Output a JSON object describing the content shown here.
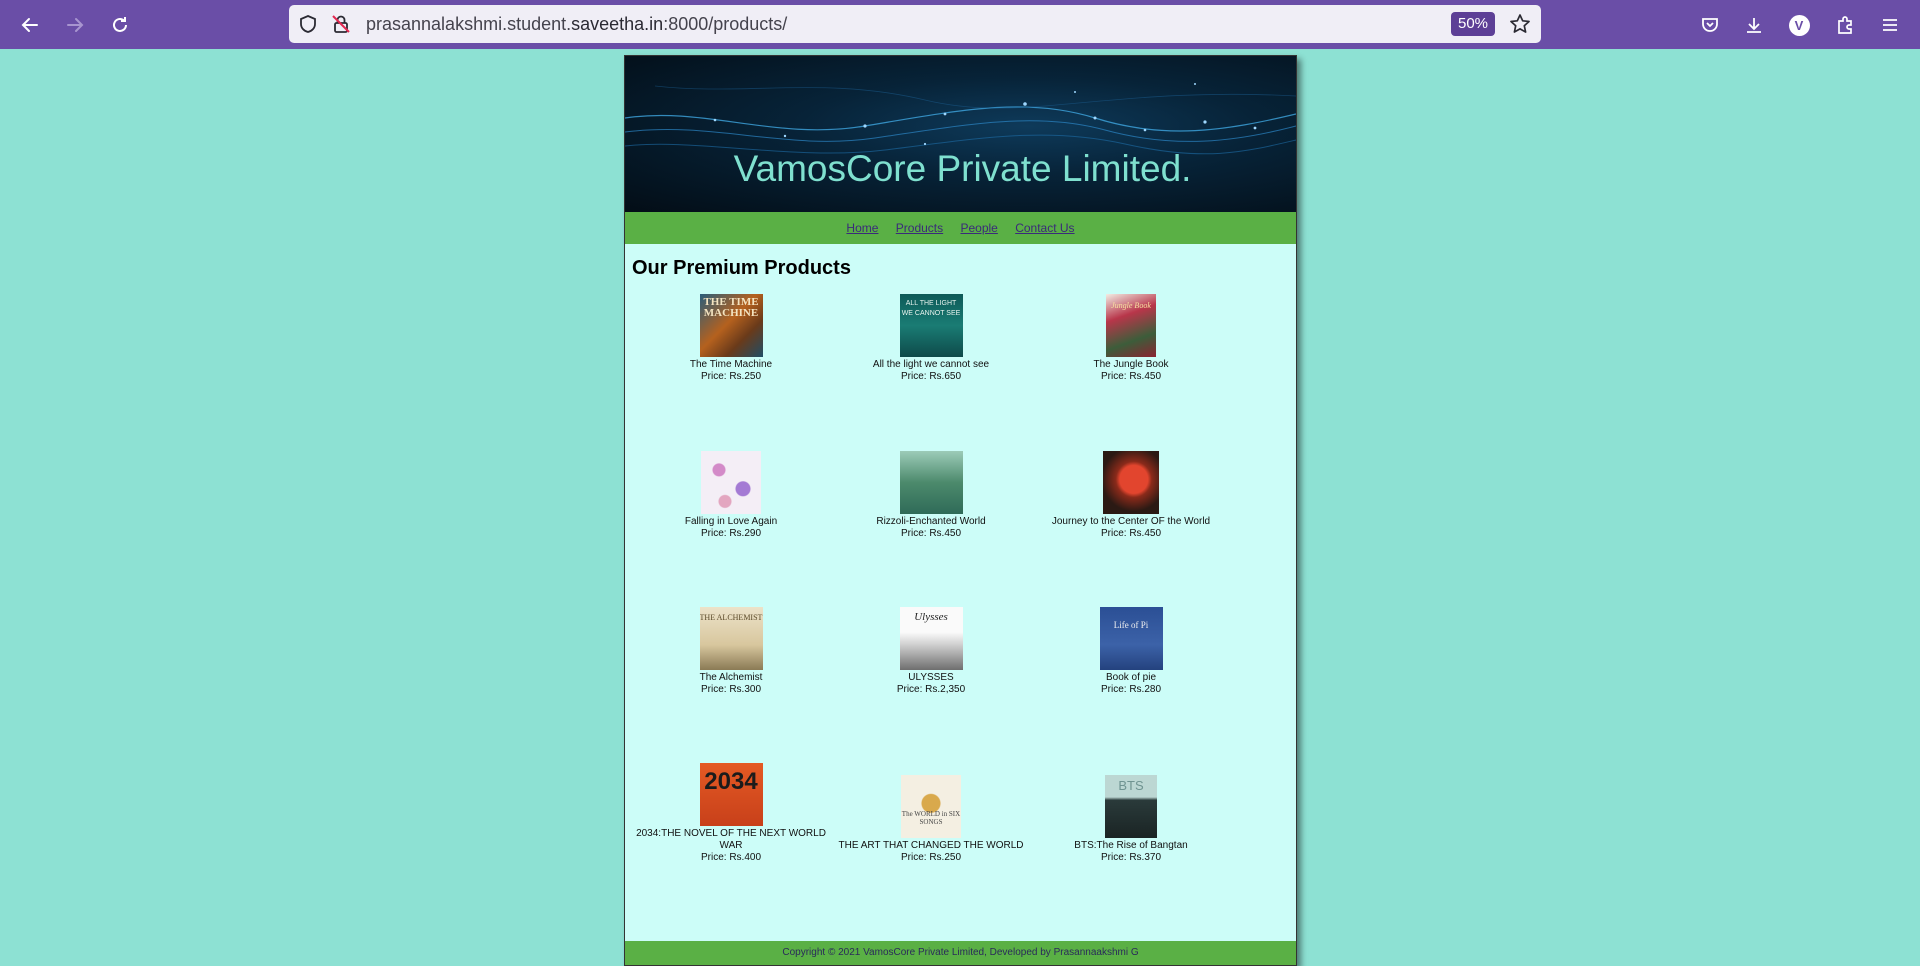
{
  "browser": {
    "url_prefix": "prasannalakshmi.student.",
    "url_domain": "saveetha.in",
    "url_suffix": ":8000/products/",
    "zoom": "50%",
    "profile_initial": "V"
  },
  "site": {
    "title": "VamosCore Private Limited.",
    "nav": [
      "Home",
      "Products",
      "People",
      "Contact Us"
    ],
    "heading": "Our Premium Products",
    "footer": "Copyright © 2021 VamosCore Private Limited, Developed by Prasannaakshmi G"
  },
  "products": [
    {
      "name": "The Time Machine",
      "price": "Price: Rs.250",
      "cover_text": "THE TIME MACHINE"
    },
    {
      "name": "All the light we cannot see",
      "price": "Price: Rs.650",
      "cover_text": "ALL THE LIGHT WE CANNOT SEE"
    },
    {
      "name": "The Jungle Book",
      "price": "Price: Rs.450",
      "cover_text": "Jungle Book"
    },
    {
      "name": "Falling in Love Again",
      "price": "Price: Rs.290",
      "cover_text": ""
    },
    {
      "name": "Rizzoli-Enchanted World",
      "price": "Price: Rs.450",
      "cover_text": ""
    },
    {
      "name": "Journey to the Center OF the World",
      "price": "Price: Rs.450",
      "cover_text": ""
    },
    {
      "name": "The Alchemist",
      "price": "Price: Rs.300",
      "cover_text": "THE ALCHEMIST"
    },
    {
      "name": "ULYSSES",
      "price": "Price: Rs.2,350",
      "cover_text": "Ulysses"
    },
    {
      "name": "Book of pie",
      "price": "Price: Rs.280",
      "cover_text": "Life of Pi"
    },
    {
      "name": "2034:THE NOVEL OF THE NEXT WORLD WAR",
      "price": "Price: Rs.400",
      "cover_text": "2034"
    },
    {
      "name": "THE ART THAT CHANGED THE WORLD",
      "price": "Price: Rs.250",
      "cover_text": "The WORLD in SIX SONGS"
    },
    {
      "name": "BTS:The Rise of Bangtan",
      "price": "Price: Rs.370",
      "cover_text": "BTS"
    }
  ]
}
